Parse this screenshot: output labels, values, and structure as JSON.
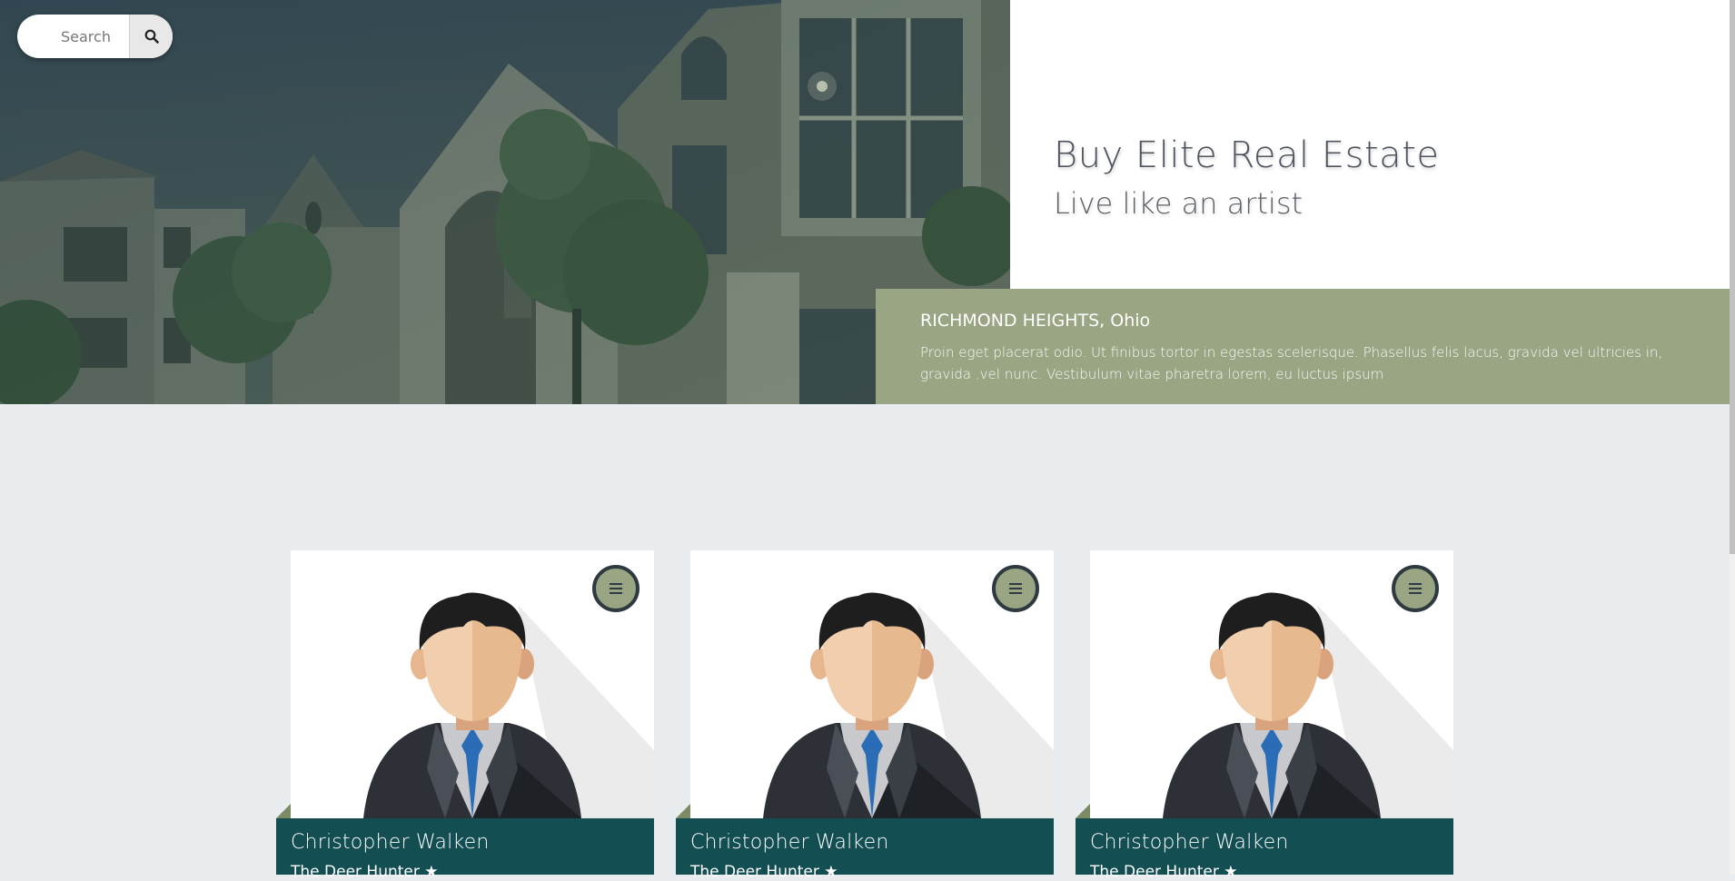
{
  "search": {
    "placeholder": "Search",
    "icon": "search-icon"
  },
  "hero": {
    "title": "Buy Elite Real Estate",
    "subtitle": "Live like an artist"
  },
  "location": {
    "title": "RICHMOND HEIGHTS, Ohio",
    "description": "Proin eget placerat odio. Ut finibus tortor in egestas scelerisque. Phasellus felis lacus, gravida vel ultricies in, gravida .vel nunc. Vestibulum vitae pharetra lorem, eu luctus ipsum"
  },
  "agents": [
    {
      "name": "Christopher Walken",
      "role": "The Deer Hunter",
      "role_icon": "star-icon",
      "menu_icon": "menu-icon"
    },
    {
      "name": "Christopher Walken",
      "role": "The Deer Hunter",
      "role_icon": "star-icon",
      "menu_icon": "menu-icon"
    },
    {
      "name": "Christopher Walken",
      "role": "The Deer Hunter",
      "role_icon": "star-icon",
      "menu_icon": "menu-icon"
    }
  ],
  "colors": {
    "accent_green": "#9aa584",
    "dark_teal": "#124e52",
    "page_bg": "#e9edf0",
    "menu_border": "#2e3a40"
  }
}
